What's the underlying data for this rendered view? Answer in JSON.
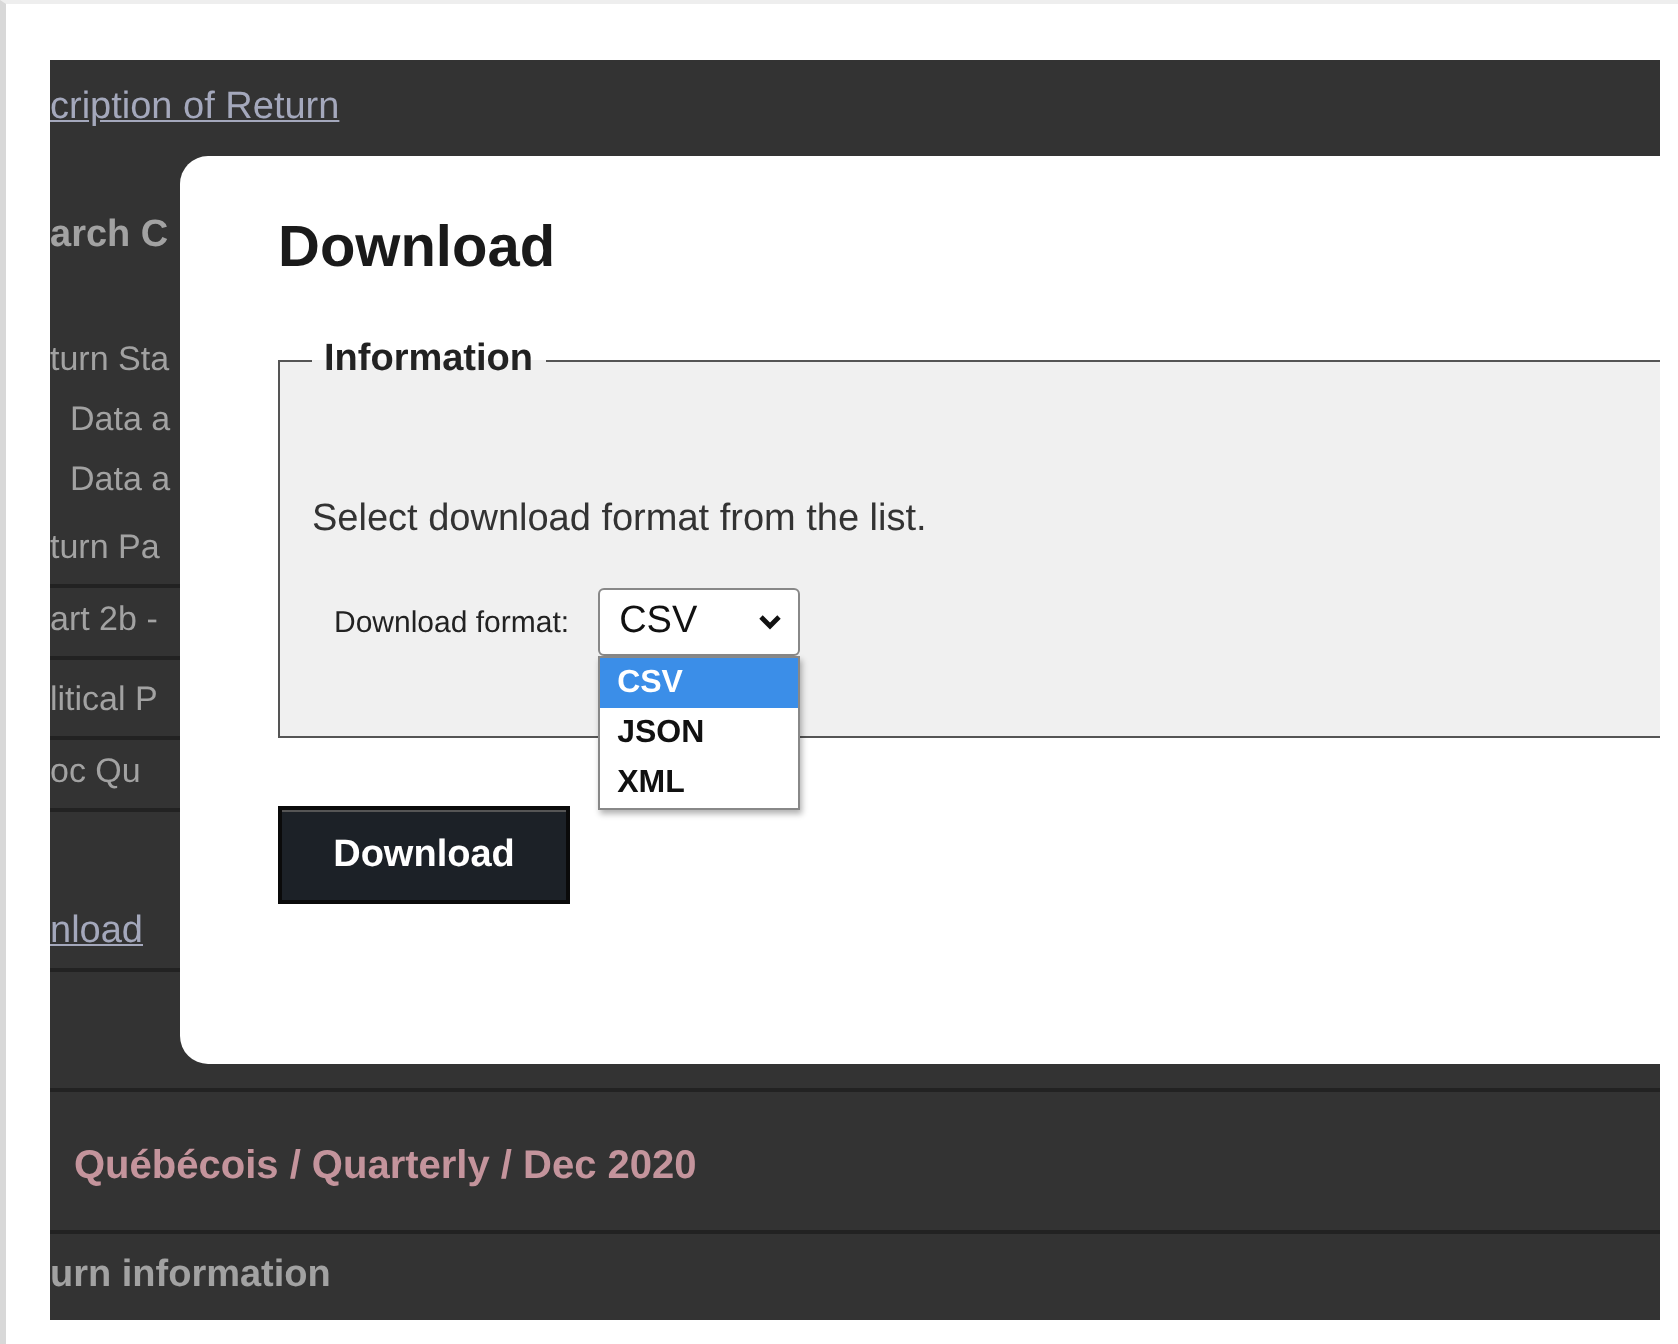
{
  "background_page": {
    "items": [
      {
        "kind": "link",
        "text": "cription of Return",
        "rule_below": false
      },
      {
        "kind": "heading",
        "text": "arch C",
        "rule_below": false
      },
      {
        "kind": "label",
        "text": "turn Sta",
        "rule_below": false
      },
      {
        "kind": "option",
        "text": "Data a",
        "rule_below": false
      },
      {
        "kind": "option",
        "text": "Data a",
        "rule_below": false
      },
      {
        "kind": "label",
        "text": "turn Pa",
        "rule_below": true
      },
      {
        "kind": "value",
        "text": "art 2b -",
        "rule_below": true
      },
      {
        "kind": "label",
        "text": "litical P",
        "rule_below": true
      },
      {
        "kind": "value",
        "text": "oc Qu",
        "rule_below": true
      },
      {
        "kind": "link",
        "text": "nload",
        "rule_below": true
      }
    ],
    "breadcrumb": "Québécois / Quarterly / Dec 2020",
    "section_heading": "urn information"
  },
  "modal": {
    "title": "Download",
    "fieldset": {
      "legend": "Information",
      "instruction": "Select download format from the list.",
      "field_label": "Download format:",
      "select": {
        "value": "CSV",
        "expanded": true,
        "options": [
          {
            "label": "CSV",
            "selected": true
          },
          {
            "label": "JSON",
            "selected": false
          },
          {
            "label": "XML",
            "selected": false
          }
        ]
      }
    },
    "button": "Download"
  }
}
